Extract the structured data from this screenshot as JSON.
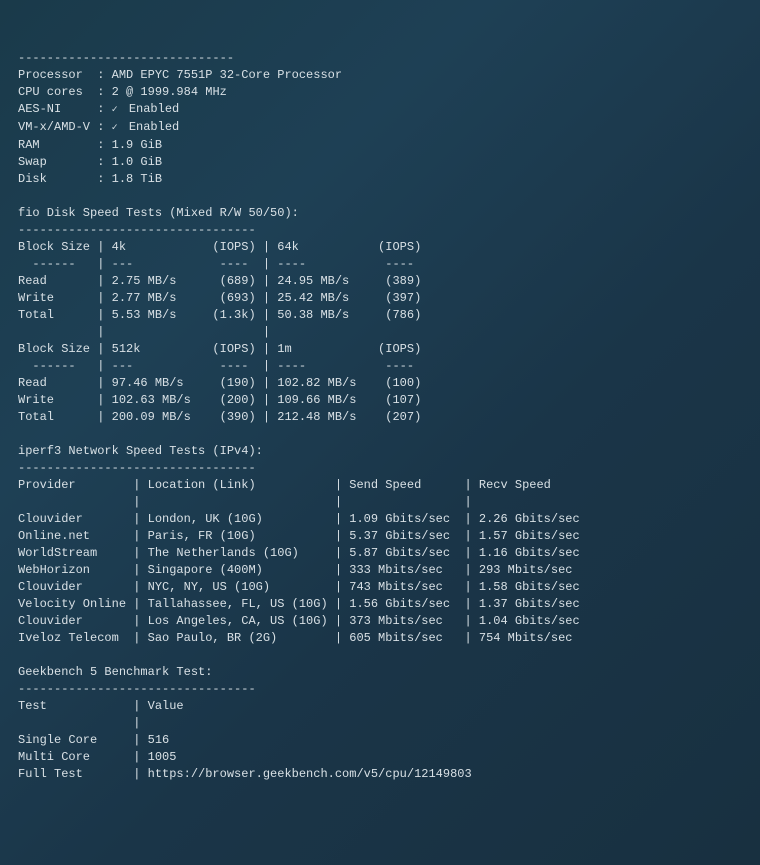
{
  "dashes30": "------------------------------",
  "sysinfo": {
    "processor_lbl": "Processor  :",
    "processor": "AMD EPYC 7551P 32-Core Processor",
    "cores_lbl": "CPU cores  :",
    "cores": "2 @ 1999.984 MHz",
    "aesni_lbl": "AES-NI     :",
    "aesni": "Enabled",
    "vmx_lbl": "VM-x/AMD-V :",
    "vmx": "Enabled",
    "ram_lbl": "RAM        :",
    "ram": "1.9 GiB",
    "swap_lbl": "Swap       :",
    "swap": "1.0 GiB",
    "disk_lbl": "Disk       :",
    "disk": "1.8 TiB"
  },
  "fio": {
    "title": "fio Disk Speed Tests (Mixed R/W 50/50):",
    "dashes": "---------------------------------",
    "hdr1": "Block Size | 4k            (IOPS) | 64k           (IOPS)",
    "sep1": "  ------   | ---            ----  | ----           ---- ",
    "r1": "Read       | 2.75 MB/s      (689) | 24.95 MB/s     (389)",
    "r2": "Write      | 2.77 MB/s      (693) | 25.42 MB/s     (397)",
    "r3": "Total      | 5.53 MB/s     (1.3k) | 50.38 MB/s     (786)",
    "gap": "           |                      |                     ",
    "hdr2": "Block Size | 512k          (IOPS) | 1m            (IOPS)",
    "sep2": "  ------   | ---            ----  | ----           ---- ",
    "r4": "Read       | 97.46 MB/s     (190) | 102.82 MB/s    (100)",
    "r5": "Write      | 102.63 MB/s    (200) | 109.66 MB/s    (107)",
    "r6": "Total      | 200.09 MB/s    (390) | 212.48 MB/s    (207)"
  },
  "iperf": {
    "title": "iperf3 Network Speed Tests (IPv4):",
    "dashes": "---------------------------------",
    "hdr": "Provider        | Location (Link)           | Send Speed      | Recv Speed     ",
    "sep": "                |                           |                 |                ",
    "rows": [
      "Clouvider       | London, UK (10G)          | 1.09 Gbits/sec  | 2.26 Gbits/sec ",
      "Online.net      | Paris, FR (10G)           | 5.37 Gbits/sec  | 1.57 Gbits/sec ",
      "WorldStream     | The Netherlands (10G)     | 5.87 Gbits/sec  | 1.16 Gbits/sec ",
      "WebHorizon      | Singapore (400M)          | 333 Mbits/sec   | 293 Mbits/sec  ",
      "Clouvider       | NYC, NY, US (10G)         | 743 Mbits/sec   | 1.58 Gbits/sec ",
      "Velocity Online | Tallahassee, FL, US (10G) | 1.56 Gbits/sec  | 1.37 Gbits/sec ",
      "Clouvider       | Los Angeles, CA, US (10G) | 373 Mbits/sec   | 1.04 Gbits/sec ",
      "Iveloz Telecom  | Sao Paulo, BR (2G)        | 605 Mbits/sec   | 754 Mbits/sec  "
    ]
  },
  "geekbench": {
    "title": "Geekbench 5 Benchmark Test:",
    "dashes": "---------------------------------",
    "hdr": "Test            | Value                                                         ",
    "sep": "                |                                                               ",
    "r1": "Single Core     | 516                                                           ",
    "r2": "Multi Core      | 1005                                                          ",
    "r3": "Full Test       | https://browser.geekbench.com/v5/cpu/12149803                 "
  }
}
